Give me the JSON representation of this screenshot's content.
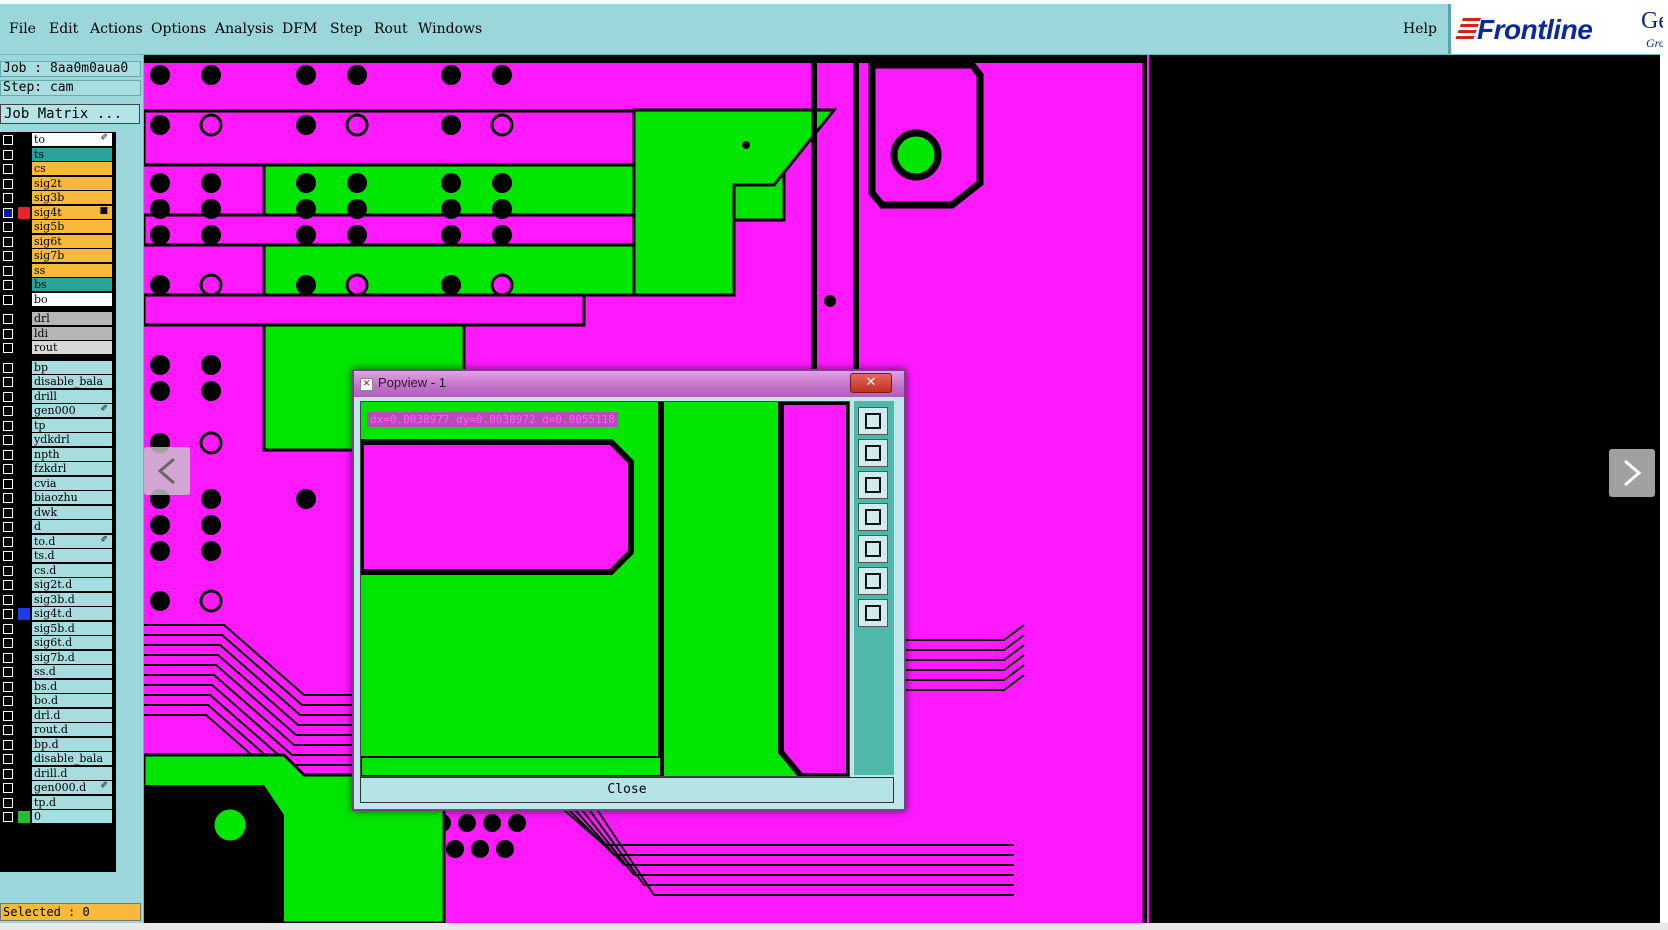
{
  "menu": {
    "items": [
      "File",
      "Edit",
      "Actions",
      "Options",
      "Analysis",
      "DFM",
      "Step",
      "Rout",
      "Windows"
    ],
    "help": "Help"
  },
  "logo": {
    "brand": "Frontline",
    "gen": "Gen",
    "gro": "Gro"
  },
  "job": {
    "job_line": "Job : 8aa0m0aua0",
    "step_line": "Step: cam",
    "matrix_label": "Job Matrix ..."
  },
  "layers": [
    {
      "name": "to",
      "bg": "#ffffff",
      "dot": "",
      "mark": "✐"
    },
    {
      "name": "ts",
      "bg": "#2aa39a",
      "dot": "",
      "mark": ""
    },
    {
      "name": "cs",
      "bg": "#f6b93a",
      "dot": "",
      "mark": ""
    },
    {
      "name": "sig2t",
      "bg": "#f6b93a",
      "dot": "",
      "mark": ""
    },
    {
      "name": "sig3b",
      "bg": "#f6b93a",
      "dot": "",
      "mark": ""
    },
    {
      "name": "sig4t",
      "bg": "#f6b93a",
      "dot": "#e8232a",
      "mark": "■",
      "checked": true
    },
    {
      "name": "sig5b",
      "bg": "#f6b93a",
      "dot": "",
      "mark": ""
    },
    {
      "name": "sig6t",
      "bg": "#f6b93a",
      "dot": "",
      "mark": ""
    },
    {
      "name": "sig7b",
      "bg": "#f6b93a",
      "dot": "",
      "mark": ""
    },
    {
      "name": "ss",
      "bg": "#f6b93a",
      "dot": "",
      "mark": ""
    },
    {
      "name": "bs",
      "bg": "#2aa39a",
      "dot": "",
      "mark": ""
    },
    {
      "name": "bo",
      "bg": "#ffffff",
      "dot": "",
      "mark": ""
    },
    {
      "name": "drl",
      "bg": "#b6b6b6",
      "dot": "",
      "mark": "",
      "gap": true
    },
    {
      "name": "ldi",
      "bg": "#b6b6b6",
      "dot": "",
      "mark": ""
    },
    {
      "name": "rout",
      "bg": "#d8d8d8",
      "dot": "",
      "mark": ""
    },
    {
      "name": "bp",
      "bg": "#a8dde0",
      "dot": "",
      "mark": "",
      "gap": true
    },
    {
      "name": "disable_bala",
      "bg": "#a8dde0",
      "dot": "",
      "mark": ""
    },
    {
      "name": "drill",
      "bg": "#a8dde0",
      "dot": "",
      "mark": ""
    },
    {
      "name": "gen000",
      "bg": "#a8dde0",
      "dot": "",
      "mark": "✐"
    },
    {
      "name": "tp",
      "bg": "#a8dde0",
      "dot": "",
      "mark": ""
    },
    {
      "name": "ydkdrl",
      "bg": "#a8dde0",
      "dot": "",
      "mark": ""
    },
    {
      "name": "npth",
      "bg": "#a8dde0",
      "dot": "",
      "mark": ""
    },
    {
      "name": "fzkdrl",
      "bg": "#a8dde0",
      "dot": "",
      "mark": ""
    },
    {
      "name": "cvia",
      "bg": "#a8dde0",
      "dot": "",
      "mark": ""
    },
    {
      "name": "biaozhu",
      "bg": "#a8dde0",
      "dot": "",
      "mark": ""
    },
    {
      "name": "dwk",
      "bg": "#a8dde0",
      "dot": "",
      "mark": ""
    },
    {
      "name": "d",
      "bg": "#a8dde0",
      "dot": "",
      "mark": ""
    },
    {
      "name": "to.d",
      "bg": "#a8dde0",
      "dot": "",
      "mark": "✐"
    },
    {
      "name": "ts.d",
      "bg": "#a8dde0",
      "dot": "",
      "mark": ""
    },
    {
      "name": "cs.d",
      "bg": "#a8dde0",
      "dot": "",
      "mark": ""
    },
    {
      "name": "sig2t.d",
      "bg": "#a8dde0",
      "dot": "",
      "mark": ""
    },
    {
      "name": "sig3b.d",
      "bg": "#a8dde0",
      "dot": "",
      "mark": ""
    },
    {
      "name": "sig4t.d",
      "bg": "#a8dde0",
      "dot": "#1e3bea",
      "mark": ""
    },
    {
      "name": "sig5b.d",
      "bg": "#a8dde0",
      "dot": "",
      "mark": ""
    },
    {
      "name": "sig6t.d",
      "bg": "#a8dde0",
      "dot": "",
      "mark": ""
    },
    {
      "name": "sig7b.d",
      "bg": "#a8dde0",
      "dot": "",
      "mark": ""
    },
    {
      "name": "ss.d",
      "bg": "#a8dde0",
      "dot": "",
      "mark": ""
    },
    {
      "name": "bs.d",
      "bg": "#a8dde0",
      "dot": "",
      "mark": ""
    },
    {
      "name": "bo.d",
      "bg": "#a8dde0",
      "dot": "",
      "mark": ""
    },
    {
      "name": "drl.d",
      "bg": "#a8dde0",
      "dot": "",
      "mark": ""
    },
    {
      "name": "rout.d",
      "bg": "#a8dde0",
      "dot": "",
      "mark": ""
    },
    {
      "name": "bp.d",
      "bg": "#a8dde0",
      "dot": "",
      "mark": ""
    },
    {
      "name": "disable_bala",
      "bg": "#a8dde0",
      "dot": "",
      "mark": ""
    },
    {
      "name": "drill.d",
      "bg": "#a8dde0",
      "dot": "",
      "mark": ""
    },
    {
      "name": "gen000.d",
      "bg": "#a8dde0",
      "dot": "",
      "mark": "✐"
    },
    {
      "name": "tp.d",
      "bg": "#a8dde0",
      "dot": "",
      "mark": ""
    },
    {
      "name": "0",
      "bg": "#a8dde0",
      "dot": "#22c02a",
      "mark": ""
    }
  ],
  "status": {
    "selected": "Selected : 0"
  },
  "popview": {
    "title": "Popview - 1",
    "readout": "dx=0.0038977 dy=0.0038972 d=0.0055118",
    "close_label": "Close",
    "tools": [
      "zoom-home-icon",
      "zoom-up-icon",
      "zoom-down-icon",
      "pan-left-icon",
      "pan-right-icon",
      "fit-icon",
      "center-icon"
    ]
  },
  "colors": {
    "board": "#ff19ff",
    "copper": "#00e600",
    "panel": "#9bd7da",
    "background": "#000000"
  }
}
